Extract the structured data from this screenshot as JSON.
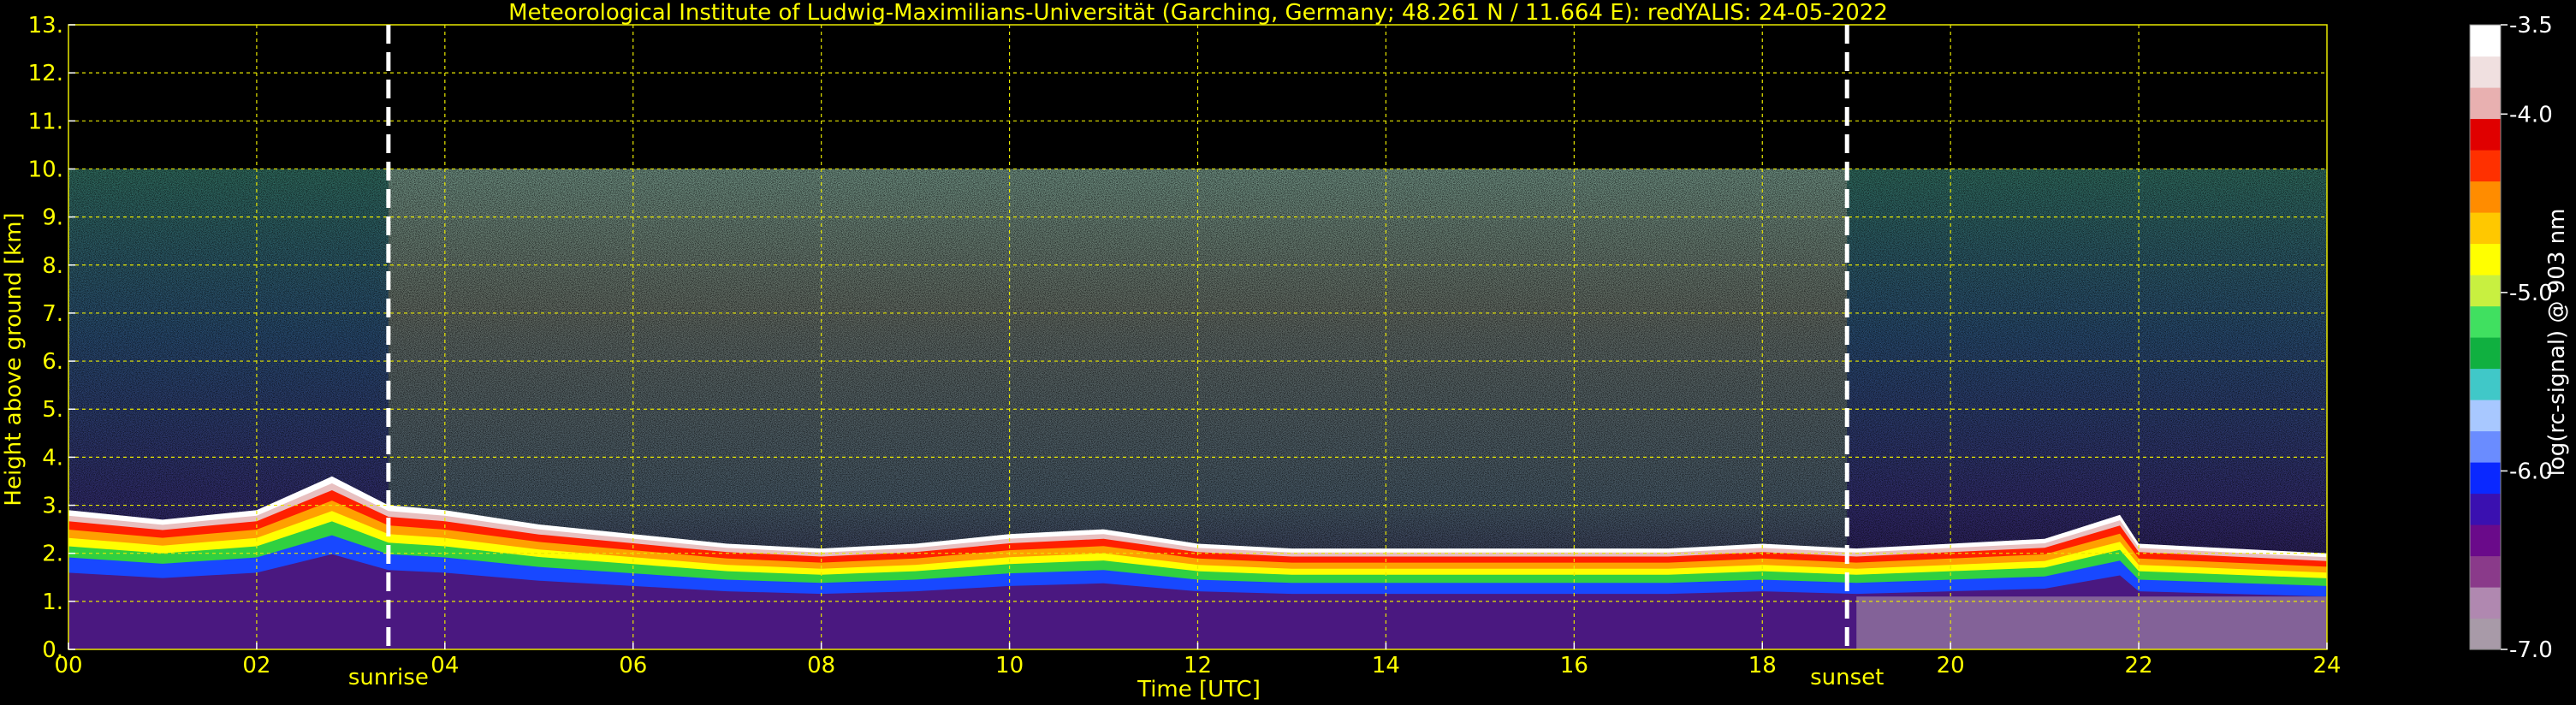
{
  "chart_data": {
    "type": "heatmap",
    "title": "Meteorological Institute of Ludwig-Maximilians-Universität (Garching, Germany; 48.261 N / 11.664 E):    redYALIS: 24-05-2022",
    "xlabel": "Time [UTC]",
    "ylabel": "Height above ground [km]",
    "xlim": [
      0,
      24
    ],
    "ylim": [
      0,
      13
    ],
    "x_ticks": [
      0,
      2,
      4,
      6,
      8,
      10,
      12,
      14,
      16,
      18,
      20,
      22,
      24
    ],
    "x_tick_labels": [
      "00",
      "02",
      "04",
      "06",
      "08",
      "10",
      "12",
      "14",
      "16",
      "18",
      "20",
      "22",
      "24"
    ],
    "y_ticks": [
      0,
      1,
      2,
      3,
      4,
      5,
      6,
      7,
      8,
      9,
      10,
      11,
      12,
      13
    ],
    "y_tick_labels": [
      "0.",
      "1.",
      "2.",
      "3.",
      "4.",
      "5.",
      "6.",
      "7.",
      "8.",
      "9.",
      "10.",
      "11.",
      "12.",
      "13."
    ],
    "grid": true,
    "signal_top_km": 10.0,
    "markers": [
      {
        "label": "sunrise",
        "x": 3.4
      },
      {
        "label": "sunset",
        "x": 18.9
      }
    ],
    "boundary_layer_top_km": [
      [
        0.0,
        2.9
      ],
      [
        1.0,
        2.7
      ],
      [
        2.0,
        2.9
      ],
      [
        2.8,
        3.6
      ],
      [
        3.4,
        3.0
      ],
      [
        4.0,
        2.9
      ],
      [
        5.0,
        2.6
      ],
      [
        6.0,
        2.4
      ],
      [
        6.5,
        2.3
      ],
      [
        7.0,
        2.2
      ],
      [
        8.0,
        2.1
      ],
      [
        9.0,
        2.2
      ],
      [
        10.0,
        2.4
      ],
      [
        11.0,
        2.5
      ],
      [
        12.0,
        2.2
      ],
      [
        13.0,
        2.1
      ],
      [
        14.0,
        2.1
      ],
      [
        15.0,
        2.1
      ],
      [
        16.0,
        2.1
      ],
      [
        17.0,
        2.1
      ],
      [
        18.0,
        2.2
      ],
      [
        19.0,
        2.1
      ],
      [
        20.0,
        2.2
      ],
      [
        21.0,
        2.3
      ],
      [
        21.8,
        2.8
      ],
      [
        22.0,
        2.2
      ],
      [
        23.0,
        2.1
      ],
      [
        24.0,
        2.0
      ]
    ],
    "colorbar": {
      "label": "log(rc-signal) @ 903 nm",
      "range": [
        -7.0,
        -3.5
      ],
      "ticks": [
        -3.5,
        -4.0,
        -5.0,
        -6.0,
        -7.0
      ],
      "tick_labels": [
        "-3.5",
        "-4.0",
        "-5.0",
        "-6.0",
        "-7.0"
      ],
      "colors": [
        "#a89aa8",
        "#b088b0",
        "#8a3a8a",
        "#6a0a8a",
        "#3a10b0",
        "#0a28ff",
        "#6a8cff",
        "#a8c8ff",
        "#40c8c8",
        "#10b040",
        "#40e060",
        "#c8f040",
        "#ffff00",
        "#ffc800",
        "#ff8c00",
        "#ff3000",
        "#e00000",
        "#e8b0b0",
        "#f0e0e0",
        "#ffffff"
      ]
    },
    "text_color": "#ffff00",
    "grid_color": "#e8e800"
  }
}
